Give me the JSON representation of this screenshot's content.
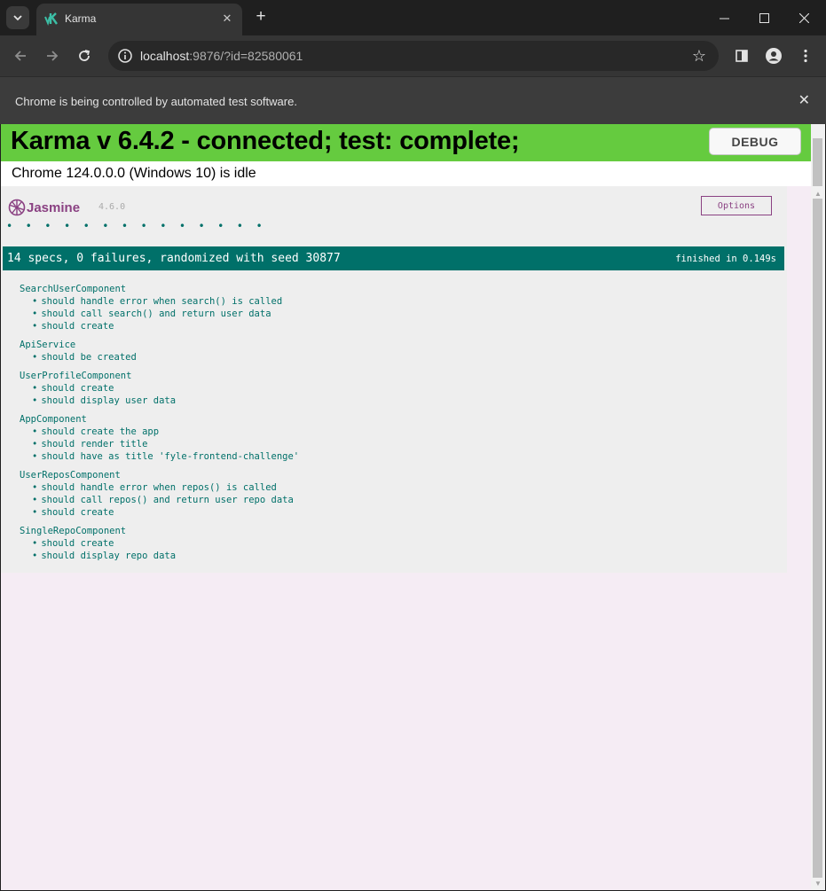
{
  "tab": {
    "title": "Karma"
  },
  "toolbar": {
    "url_host": "localhost",
    "url_rest": ":9876/?id=82580061"
  },
  "infobar": {
    "message": "Chrome is being controlled by automated test software."
  },
  "karma": {
    "banner": "Karma v 6.4.2 - connected; test: complete;",
    "debug_label": "DEBUG",
    "browser_status": "Chrome 124.0.0.0 (Windows 10) is idle"
  },
  "jasmine": {
    "logo_text": "Jasmine",
    "version": "4.6.0",
    "options_label": "Options",
    "dots": "• • • • • • • • • • • • • •",
    "summary": "14 specs, 0 failures, randomized with seed 30877",
    "duration": "finished in 0.149s",
    "suites": [
      {
        "name": "SearchUserComponent",
        "specs": [
          "should handle error when search() is called",
          "should call search() and return user data",
          "should create"
        ]
      },
      {
        "name": "ApiService",
        "specs": [
          "should be created"
        ]
      },
      {
        "name": "UserProfileComponent",
        "specs": [
          "should create",
          "should display user data"
        ]
      },
      {
        "name": "AppComponent",
        "specs": [
          "should create the app",
          "should render title",
          "should have as title 'fyle-frontend-challenge'"
        ]
      },
      {
        "name": "UserReposComponent",
        "specs": [
          "should handle error when repos() is called",
          "should call repos() and return user repo data",
          "should create"
        ]
      },
      {
        "name": "SingleRepoComponent",
        "specs": [
          "should create",
          "should display repo data"
        ]
      }
    ]
  },
  "colors": {
    "karma_green": "#65cb3f",
    "jasmine_teal": "#007069",
    "jasmine_purple": "#8a4182"
  }
}
